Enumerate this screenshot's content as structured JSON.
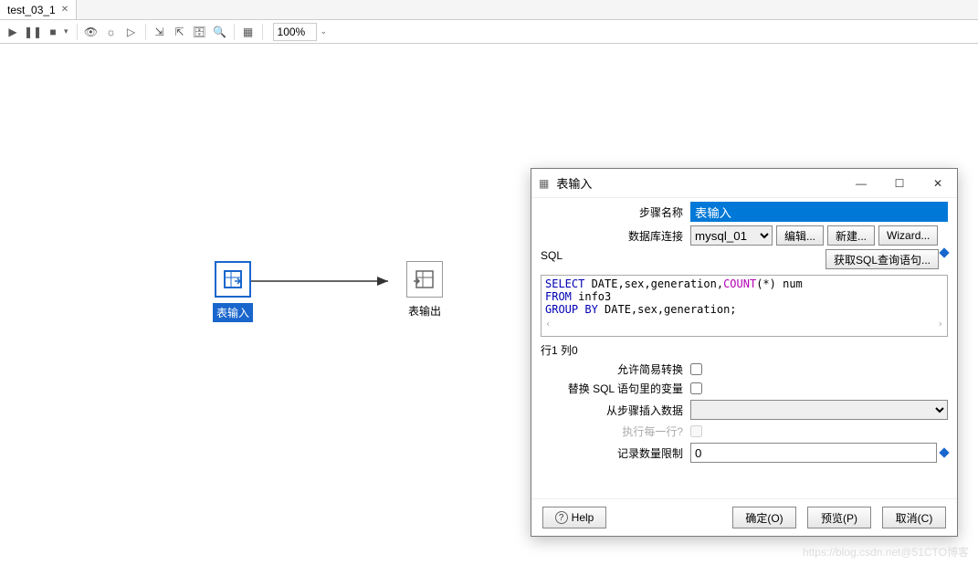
{
  "tab": {
    "title": "test_03_1",
    "close_glyph": "✕"
  },
  "toolbar": {
    "play": "▶",
    "pause": "❚❚",
    "stop": "■",
    "eye": "👁",
    "sun": "☼",
    "arrow": "▷",
    "group1": "⇲",
    "group2": "⇱",
    "db": "🗄",
    "search": "🔍",
    "grid": "▦",
    "zoom_value": "100%",
    "zoom_dropdown": "⌄"
  },
  "canvas": {
    "node_input": {
      "label": "表输入"
    },
    "node_output": {
      "label": "表输出"
    }
  },
  "dialog": {
    "icon": "▦",
    "title": "表输入",
    "minimize": "—",
    "maximize": "☐",
    "close": "✕",
    "step_name_label": "步骤名称",
    "step_name_value": "表输入",
    "db_conn_label": "数据库连接",
    "db_conn_value": "mysql_01",
    "edit_btn": "编辑...",
    "new_btn": "新建...",
    "wizard_btn": "Wizard...",
    "sql_label": "SQL",
    "get_sql_btn": "获取SQL查询语句...",
    "sql_code": {
      "line1_a": "SELECT",
      "line1_b": " DATE,sex,generation,",
      "line1_c": "COUNT",
      "line1_d": "(*) num",
      "line2_a": "FROM",
      "line2_b": " info3",
      "line3_a": "GROUP BY",
      "line3_b": " DATE,sex,generation;"
    },
    "scroll_left": "‹",
    "scroll_right": "›",
    "status": "行1 列0",
    "allow_lazy_label": "允许简易转换",
    "replace_vars_label": "替换 SQL 语句里的变量",
    "insert_from_step_label": "从步骤插入数据",
    "insert_from_step_value": "",
    "exec_each_row_label": "执行每一行?",
    "limit_label": "记录数量限制",
    "limit_value": "0",
    "help_btn": "Help",
    "ok_btn": "确定(O)",
    "preview_btn": "预览(P)",
    "cancel_btn": "取消(C)"
  },
  "watermark": "https://blog.csdn.net@51CTO博客"
}
